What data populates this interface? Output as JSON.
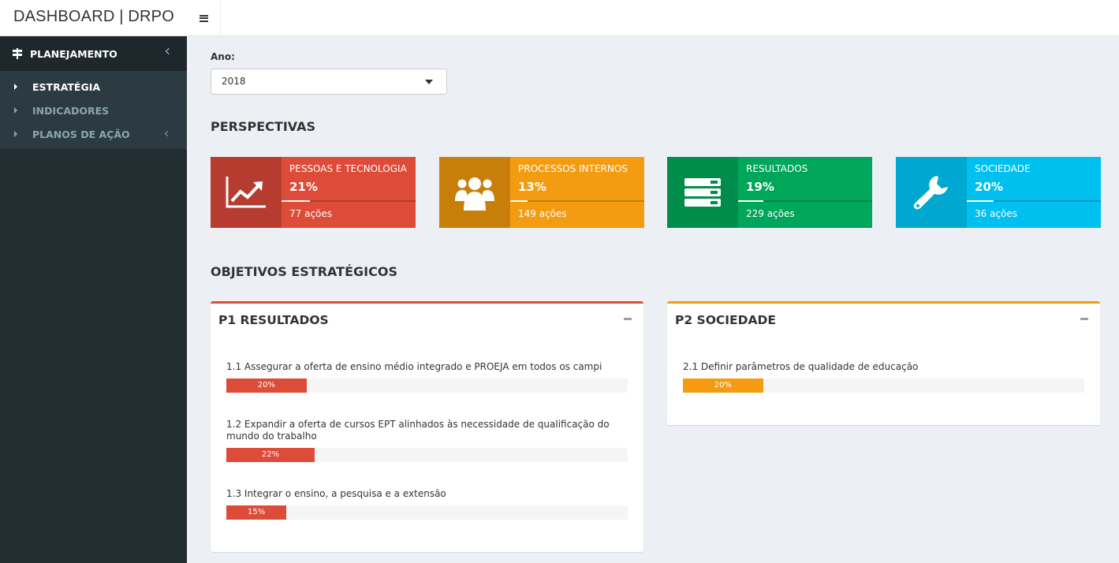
{
  "app": {
    "title": "DASHBOARD | DRPO"
  },
  "sidebar": {
    "header": {
      "label": "PLANEJAMENTO"
    },
    "items": [
      {
        "label": "ESTRATÉGIA"
      },
      {
        "label": "INDICADORES"
      },
      {
        "label": "PLANOS DE AÇÃO"
      }
    ]
  },
  "filter": {
    "label": "Ano:",
    "value": "2018"
  },
  "perspectives": {
    "title": "PERSPECTIVAS",
    "boxes": [
      {
        "text": "PESSOAS E TECNOLOGIA",
        "number": "21%",
        "progress": 0.21,
        "desc": "77 ações",
        "icon": "chart-line-icon",
        "color": "#dd4b39"
      },
      {
        "text": "PROCESSOS INTERNOS",
        "number": "13%",
        "progress": 0.13,
        "desc": "149 ações",
        "icon": "users-icon",
        "color": "#f39c12"
      },
      {
        "text": "RESULTADOS",
        "number": "19%",
        "progress": 0.19,
        "desc": "229 ações",
        "icon": "server-icon",
        "color": "#00a65a"
      },
      {
        "text": "SOCIEDADE",
        "number": "20%",
        "progress": 0.2,
        "desc": "36 ações",
        "icon": "wrench-icon",
        "color": "#00c0ef"
      }
    ]
  },
  "objectives": {
    "title": "OBJETIVOS ESTRATÉGICOS",
    "panels": [
      {
        "title": "P1 RESULTADOS",
        "color": "#dd4b39",
        "goals": [
          {
            "text": "1.1 Assegurar a oferta de ensino médio integrado e PROEJA em todos os campi",
            "value": 20,
            "label": "20%"
          },
          {
            "text": "1.2 Expandir a oferta de cursos EPT alinhados às necessidade de qualificação do mundo do trabalho",
            "value": 22,
            "label": "22%"
          },
          {
            "text": "1.3 Integrar o ensino, a pesquisa e a extensão",
            "value": 15,
            "label": "15%"
          }
        ]
      },
      {
        "title": "P2 SOCIEDADE",
        "color": "#f39c12",
        "goals": [
          {
            "text": "2.1 Definir parâmetros de qualidade de educação",
            "value": 20,
            "label": "20%"
          }
        ]
      }
    ]
  }
}
